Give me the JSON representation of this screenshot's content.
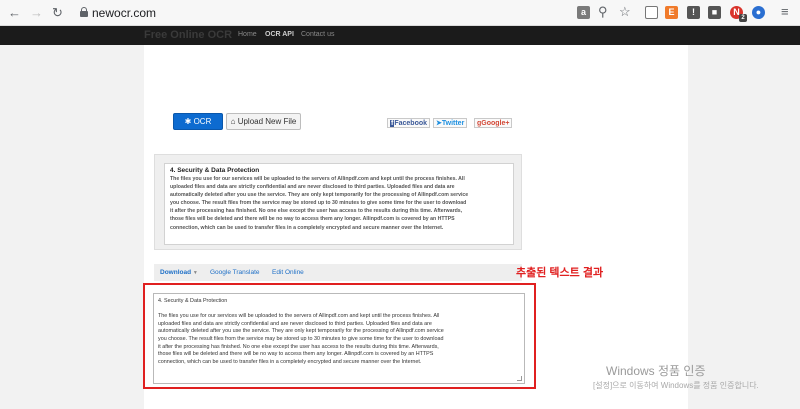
{
  "browser": {
    "url": "newocr.com",
    "toolbar_icons": [
      "translate-icon",
      "zoom-icon",
      "star-icon",
      "cast-icon",
      "extension-icon",
      "extension-icon",
      "extension-icon",
      "profile-icon",
      "profile-icon",
      "menu-icon"
    ],
    "ext_badge": "2"
  },
  "site": {
    "brand": "Free Online OCR",
    "nav": [
      "Home",
      "OCR API",
      "Contact us"
    ]
  },
  "toolbar": {
    "ocr_label": "OCR",
    "upload_label": "Upload New File",
    "facebook": "Facebook",
    "twitter": "Twitter",
    "google": "Google+"
  },
  "source_box": {
    "title": "4. Security & Data Protection",
    "lines": [
      "The files you use for our services will be uploaded to the servers of Allinpdf.com and kept until the process finishes. All",
      "uploaded files and data are strictly confidential and are never disclosed to third parties. Uploaded files and data are",
      "automatically deleted after you use the service. They are only kept temporarily for the processing of Allinpdf.com service",
      "you choose. The result files from the service may be stored up to 30 minutes to give some time for the user to download",
      "it after the processing has finished. No one else except the user has access to the results during this time. Afterwards,",
      "those files will be deleted and there will be no way to access them any longer. Allinpdf.com is covered by an HTTPS",
      "connection, which can be used to transfer files in a completely encrypted and secure manner over the Internet."
    ]
  },
  "result_tabs": {
    "download": "Download",
    "google_translate": "Google Translate",
    "edit_online": "Edit Online"
  },
  "result": {
    "title": "4. Security & Data Protection",
    "lines": [
      "The files you use for our services will be uploaded to the servers of Allinpdf.com and kept until the process finishes. All",
      "uploaded files and data are strictly confidential and are never disclosed to third parties. Uploaded files and data are",
      "automatically deleted after you use the service. They are only kept temporarily for the processing of Allinpdf.com service",
      "you choose. The result files from the service may be stored up to 30 minutes to give some time for the user to download",
      "it after the processing has finished. No one else except the user has access to the results during this time. Afterwards,",
      "those files will be deleted and there will be no way to access them any longer. Allinpdf.com is covered by an HTTPS",
      "connection, which can be used to transfer files in a completely encrypted and secure manner over the Internet."
    ]
  },
  "annotation": "추출된 텍스트 결과",
  "watermark": {
    "title": "Windows 정품 인증",
    "subtitle": "[설정]으로 이동하여 Windows를 정품 인증합니다."
  },
  "colors": {
    "ocr_button": "#0d6bd0",
    "highlight": "#e02020",
    "nav_bar": "#1b1b1b"
  }
}
